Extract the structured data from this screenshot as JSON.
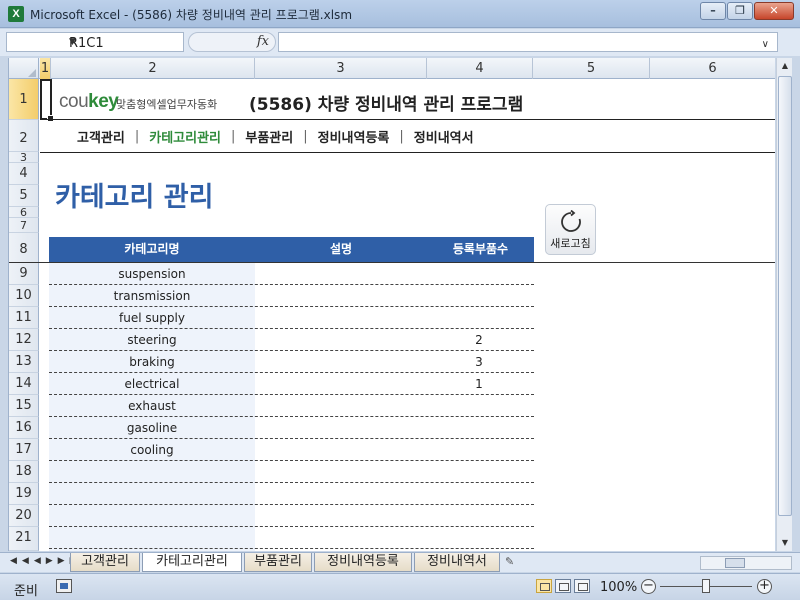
{
  "window": {
    "title": "Microsoft Excel - (5586) 차량 정비내역 관리 프로그램.xlsm",
    "app_icon": "X"
  },
  "formula_bar": {
    "name_box": "R1C1",
    "fx_label": "fx",
    "formula": ""
  },
  "columns": [
    "1",
    "2",
    "3",
    "4",
    "5",
    "6"
  ],
  "rows": [
    "1",
    "2",
    "3",
    "4",
    "5",
    "6",
    "7",
    "8",
    "9",
    "10",
    "11",
    "12",
    "13",
    "14",
    "15",
    "16",
    "17",
    "18",
    "19",
    "20",
    "21"
  ],
  "header": {
    "logo_main": "cou",
    "logo_accent": "key",
    "logo_sub": "맞춤형엑셀업무자동화",
    "app_title": "(5586) 차량 정비내역 관리 프로그램"
  },
  "menu": {
    "items": [
      "고객관리",
      "카테고리관리",
      "부품관리",
      "정비내역등록",
      "정비내역서"
    ],
    "separator": "|",
    "active_index": 1
  },
  "page": {
    "heading": "카테고리 관리",
    "refresh_label": "새로고침"
  },
  "table": {
    "headers": [
      "카테고리명",
      "설명",
      "등록부품수"
    ],
    "rows": [
      {
        "name": "suspension",
        "desc": "",
        "count": ""
      },
      {
        "name": "transmission",
        "desc": "",
        "count": ""
      },
      {
        "name": "fuel supply",
        "desc": "",
        "count": ""
      },
      {
        "name": "steering",
        "desc": "",
        "count": "2"
      },
      {
        "name": "braking",
        "desc": "",
        "count": "3"
      },
      {
        "name": "electrical",
        "desc": "",
        "count": "1"
      },
      {
        "name": "exhaust",
        "desc": "",
        "count": ""
      },
      {
        "name": "gasoline",
        "desc": "",
        "count": ""
      },
      {
        "name": "cooling",
        "desc": "",
        "count": ""
      },
      {
        "name": "",
        "desc": "",
        "count": ""
      },
      {
        "name": "",
        "desc": "",
        "count": ""
      },
      {
        "name": "",
        "desc": "",
        "count": ""
      },
      {
        "name": "",
        "desc": "",
        "count": ""
      }
    ]
  },
  "sheet_tabs": [
    "고객관리",
    "카테고리관리",
    "부품관리",
    "정비내역등록",
    "정비내역서"
  ],
  "active_sheet_tab": 1,
  "status": {
    "ready": "준비",
    "zoom": "100%",
    "zoom_minus": "−",
    "zoom_plus": "+"
  },
  "colors": {
    "accent_blue": "#2f5fa7",
    "accent_green": "#2e8b3a"
  }
}
